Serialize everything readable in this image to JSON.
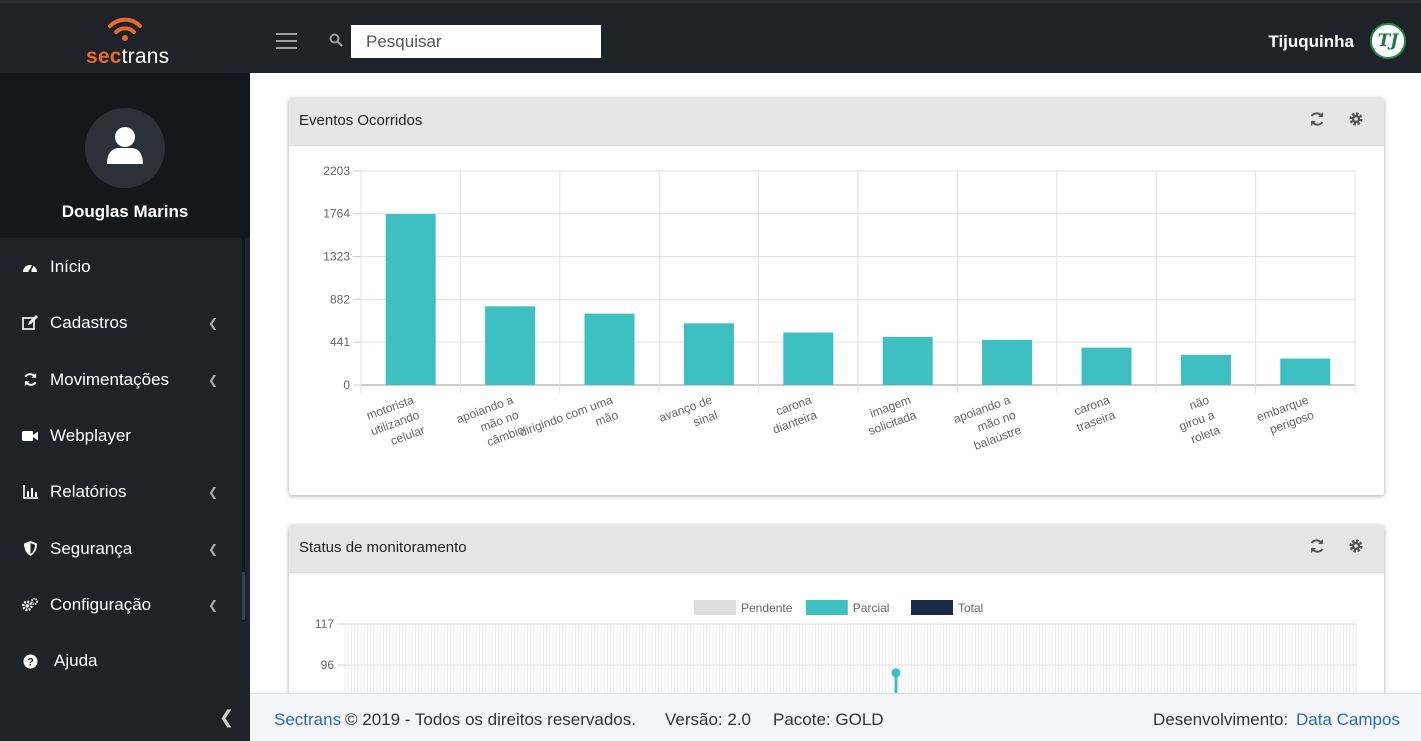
{
  "app": {
    "brand_sec": "sec",
    "brand_trans": "trans",
    "search_placeholder": "Pesquisar",
    "company_name": "Tijuquinha",
    "company_logo_text": "TJ"
  },
  "sidebar": {
    "user_name": "Douglas Marins",
    "items": [
      {
        "label": "Início",
        "icon": "dashboard-icon",
        "has_submenu": false
      },
      {
        "label": "Cadastros",
        "icon": "edit-icon",
        "has_submenu": true
      },
      {
        "label": "Movimentações",
        "icon": "refresh-icon",
        "has_submenu": true
      },
      {
        "label": "Webplayer",
        "icon": "video-camera-icon",
        "has_submenu": false
      },
      {
        "label": "Relatórios",
        "icon": "bar-chart-icon",
        "has_submenu": true
      },
      {
        "label": "Segurança",
        "icon": "shield-icon",
        "has_submenu": true
      },
      {
        "label": "Configuração",
        "icon": "cogs-icon",
        "has_submenu": true
      },
      {
        "label": "Ajuda",
        "icon": "question-circle-icon",
        "has_submenu": false
      }
    ]
  },
  "panels": {
    "events_title": "Eventos Ocorridos",
    "status_title": "Status de monitoramento"
  },
  "chart_data": [
    {
      "type": "bar",
      "title": "Eventos Ocorridos",
      "categories": [
        [
          "motorista",
          "utilizando",
          "celular"
        ],
        [
          "apoiando a",
          "mão no",
          "câmbio"
        ],
        [
          "dirigindo com uma",
          "mão"
        ],
        [
          "avanço de",
          "sinal"
        ],
        [
          "carona",
          "dianteira"
        ],
        [
          "imagem",
          "solicitada"
        ],
        [
          "apoiando a",
          "mão no",
          "balaústre"
        ],
        [
          "carona",
          "traseira"
        ],
        [
          "não",
          "girou a",
          "roleta"
        ],
        [
          "embarque",
          "perigoso"
        ]
      ],
      "values": [
        1760,
        810,
        735,
        635,
        540,
        495,
        465,
        385,
        310,
        272
      ],
      "yticks": [
        0,
        441,
        882,
        1323,
        1764,
        2203
      ],
      "ylim": [
        0,
        2203
      ],
      "color": "#3ebfc2",
      "grid": true,
      "legend": "none"
    },
    {
      "type": "line",
      "title": "Status de monitoramento",
      "legend_position": "top",
      "series": [
        {
          "name": "Pendente",
          "color": "#dddddd"
        },
        {
          "name": "Parcial",
          "color": "#3ebfc2"
        },
        {
          "name": "Total",
          "color": "#1b2a47"
        }
      ],
      "yticks": [
        96,
        117
      ],
      "visible_points": [
        {
          "series": "Parcial",
          "y": 92
        }
      ]
    }
  ],
  "footer": {
    "brand_link": "Sectrans",
    "copyright": "© 2019 - Todos os direitos reservados.",
    "version": "Versão: 2.0",
    "package": "Pacote: GOLD",
    "dev_label": "Desenvolvimento:",
    "dev_link": "Data Campos"
  }
}
